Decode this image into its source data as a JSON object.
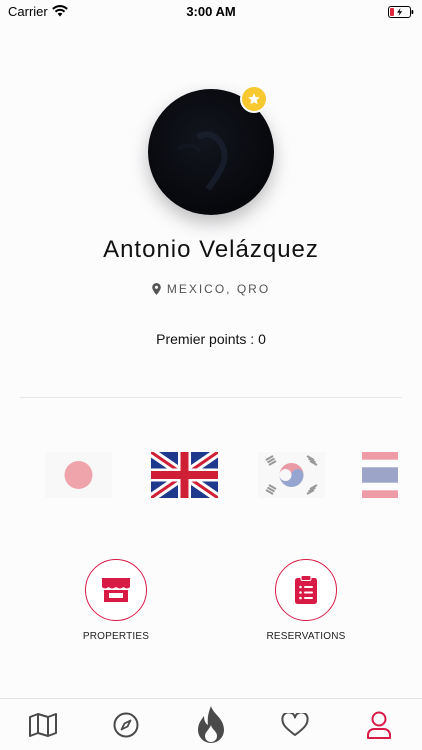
{
  "status_bar": {
    "carrier": "Carrier",
    "time": "3:00 AM"
  },
  "profile": {
    "name": "Antonio Velázquez",
    "location": "MEXICO, QRO",
    "points": "Premier points : 0",
    "badge_icon": "star-icon"
  },
  "flags": [
    {
      "name": "japan-flag"
    },
    {
      "name": "united-kingdom-flag"
    },
    {
      "name": "south-korea-flag"
    },
    {
      "name": "thailand-flag"
    }
  ],
  "actions": {
    "properties_label": "PROPERTIES",
    "reservations_label": "RESERVATIONS"
  },
  "tabbar": {
    "items": [
      "map-icon",
      "compass-icon",
      "flame-icon",
      "heart-icon",
      "user-icon"
    ],
    "active": "user-icon"
  },
  "colors": {
    "accent": "#d81b45",
    "badge": "#f7c830",
    "icon_gray": "#4a4a4a"
  }
}
